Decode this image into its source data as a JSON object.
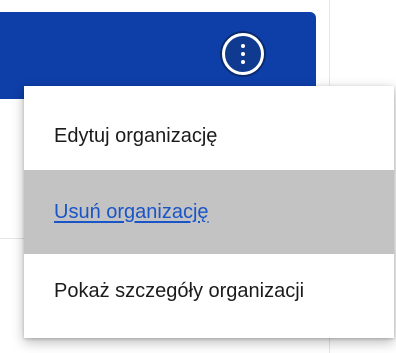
{
  "card": {
    "header_color": "#0e3fa9",
    "more_button_icon": "kebab-vertical-icon"
  },
  "menu": {
    "items": [
      {
        "label": "Edytuj organizację",
        "state": "default"
      },
      {
        "label": "Usuń organizację",
        "state": "hover"
      },
      {
        "label": "Pokaż szczegóły organizacji",
        "state": "default"
      }
    ],
    "hover_background": "#c3c3c3",
    "hover_text_color": "#1a55c7"
  }
}
